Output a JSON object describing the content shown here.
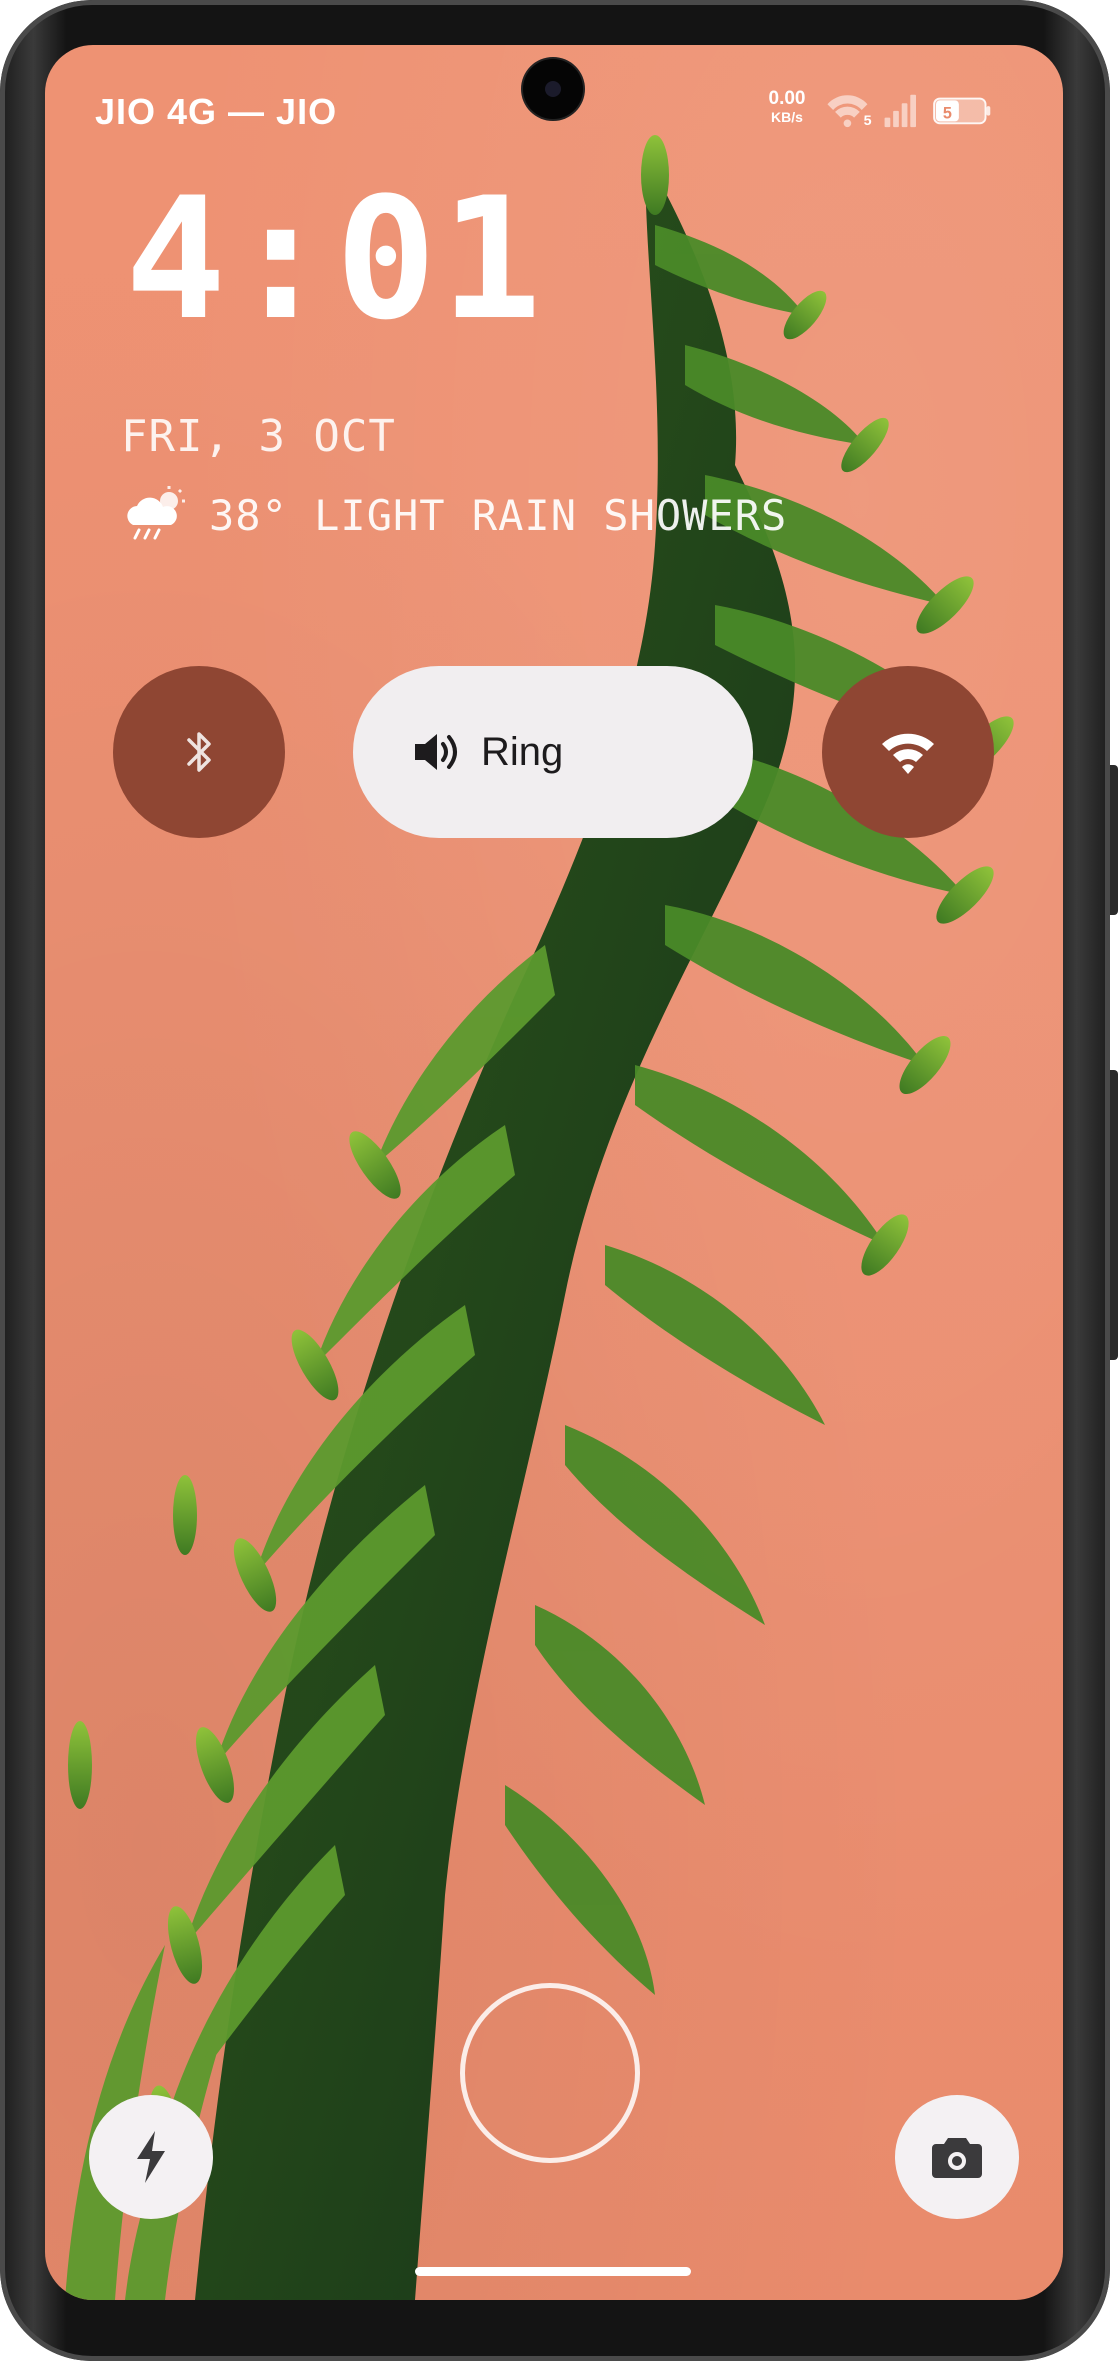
{
  "status_bar": {
    "carrier": "JIO 4G — JIO",
    "net_speed_value": "0.00",
    "net_speed_unit": "KB/s",
    "wifi_badge": "5",
    "battery_level": "5"
  },
  "lockscreen": {
    "time": "4:01",
    "date": "FRI, 3 OCT",
    "weather": {
      "icon": "rain-shower-icon",
      "text": "38° LIGHT RAIN SHOWERS"
    }
  },
  "quick_controls": {
    "bluetooth": {
      "icon": "bluetooth-icon"
    },
    "sound_mode": {
      "icon": "volume-icon",
      "label": "Ring"
    },
    "wifi": {
      "icon": "wifi-icon"
    }
  },
  "shortcuts": {
    "left": {
      "icon": "flashlight-icon"
    },
    "right": {
      "icon": "camera-icon"
    }
  },
  "colors": {
    "wallpaper": "#ec9072",
    "toggle_active": "#8f4633",
    "pill_bg": "#f1eef0",
    "plant_green": "#4f8a2a"
  }
}
